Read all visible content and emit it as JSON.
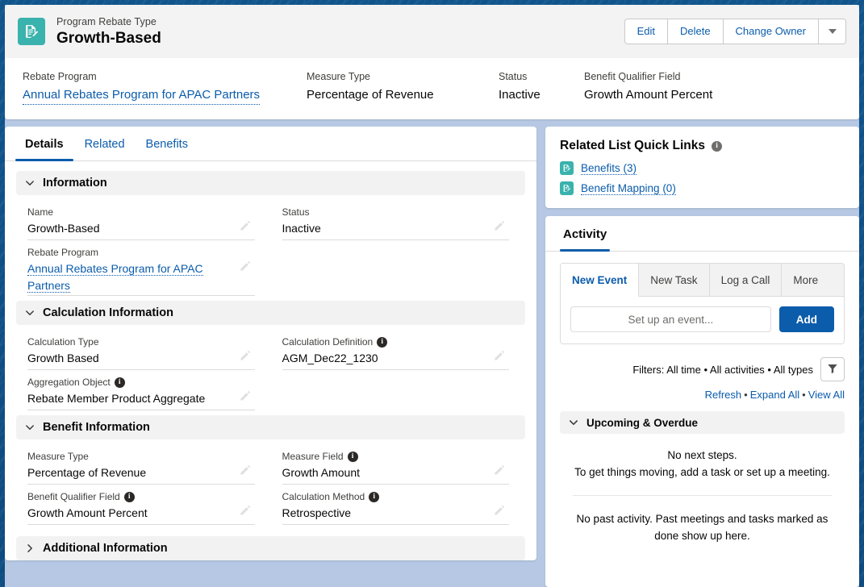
{
  "header": {
    "icon": "record-document-icon",
    "eyebrow": "Program Rebate Type",
    "title": "Growth-Based",
    "actions": [
      {
        "label": "Edit",
        "name": "edit-button"
      },
      {
        "label": "Delete",
        "name": "delete-button"
      },
      {
        "label": "Change Owner",
        "name": "change-owner-button"
      }
    ],
    "more_icon": "chevron-down-icon",
    "fields": [
      {
        "label": "Rebate Program",
        "value": "Annual Rebates Program for APAC Partners",
        "is_link": true
      },
      {
        "label": "Measure Type",
        "value": "Percentage of Revenue",
        "is_link": false
      },
      {
        "label": "Status",
        "value": "Inactive",
        "is_link": false
      },
      {
        "label": "Benefit Qualifier Field",
        "value": "Growth Amount Percent",
        "is_link": false
      }
    ]
  },
  "tabs": [
    {
      "label": "Details",
      "active": true
    },
    {
      "label": "Related",
      "active": false
    },
    {
      "label": "Benefits",
      "active": false
    }
  ],
  "details": {
    "sections": [
      {
        "title": "Information",
        "expanded": true,
        "fields": [
          {
            "label": "Name",
            "value": "Growth-Based",
            "info": false,
            "link": false
          },
          {
            "label": "Status",
            "value": "Inactive",
            "info": false,
            "link": false
          },
          {
            "label": "Rebate Program",
            "value": "Annual Rebates Program for APAC Partners",
            "info": false,
            "link": true
          }
        ]
      },
      {
        "title": "Calculation Information",
        "expanded": true,
        "fields": [
          {
            "label": "Calculation Type",
            "value": "Growth Based",
            "info": false,
            "link": false
          },
          {
            "label": "Calculation Definition",
            "value": "AGM_Dec22_1230",
            "info": true,
            "link": false
          },
          {
            "label": "Aggregation Object",
            "value": "Rebate Member Product Aggregate",
            "info": true,
            "link": false
          }
        ]
      },
      {
        "title": "Benefit Information",
        "expanded": true,
        "fields": [
          {
            "label": "Measure Type",
            "value": "Percentage of Revenue",
            "info": false,
            "link": false
          },
          {
            "label": "Measure Field",
            "value": "Growth Amount",
            "info": true,
            "link": false
          },
          {
            "label": "Benefit Qualifier Field",
            "value": "Growth Amount Percent",
            "info": true,
            "link": false
          },
          {
            "label": "Calculation Method",
            "value": "Retrospective",
            "info": true,
            "link": false
          }
        ]
      },
      {
        "title": "Additional Information",
        "expanded": false,
        "fields": []
      }
    ]
  },
  "related_links": {
    "title": "Related List Quick Links",
    "info_icon": "info-icon",
    "items": [
      {
        "label": "Benefits (3)",
        "icon": "record-document-icon"
      },
      {
        "label": "Benefit Mapping (0)",
        "icon": "record-document-icon"
      }
    ]
  },
  "activity": {
    "tab_label": "Activity",
    "publisher_tabs": [
      {
        "label": "New Event",
        "active": true
      },
      {
        "label": "New Task",
        "active": false
      },
      {
        "label": "Log a Call",
        "active": false
      },
      {
        "label": "More",
        "active": false
      }
    ],
    "input_placeholder": "Set up an event...",
    "input_value": "",
    "add_label": "Add",
    "filters_text": "Filters: All time • All activities • All types",
    "filter_icon": "filter-icon",
    "links": [
      {
        "label": "Refresh"
      },
      {
        "label": "Expand All"
      },
      {
        "label": "View All"
      }
    ],
    "link_separator": "•",
    "upcoming_title": "Upcoming & Overdue",
    "empty_next_line1": "No next steps.",
    "empty_next_line2": "To get things moving, add a task or set up a meeting.",
    "empty_past": "No past activity. Past meetings and tasks marked as done show up here."
  },
  "colors": {
    "brand_blue": "#0b5cab",
    "link_blue": "#0b5cab",
    "icon_teal": "#3ab2ad",
    "background_navy": "#10548c",
    "page_bg": "#b6c8e3",
    "section_header_bg": "#f3f2f2"
  }
}
